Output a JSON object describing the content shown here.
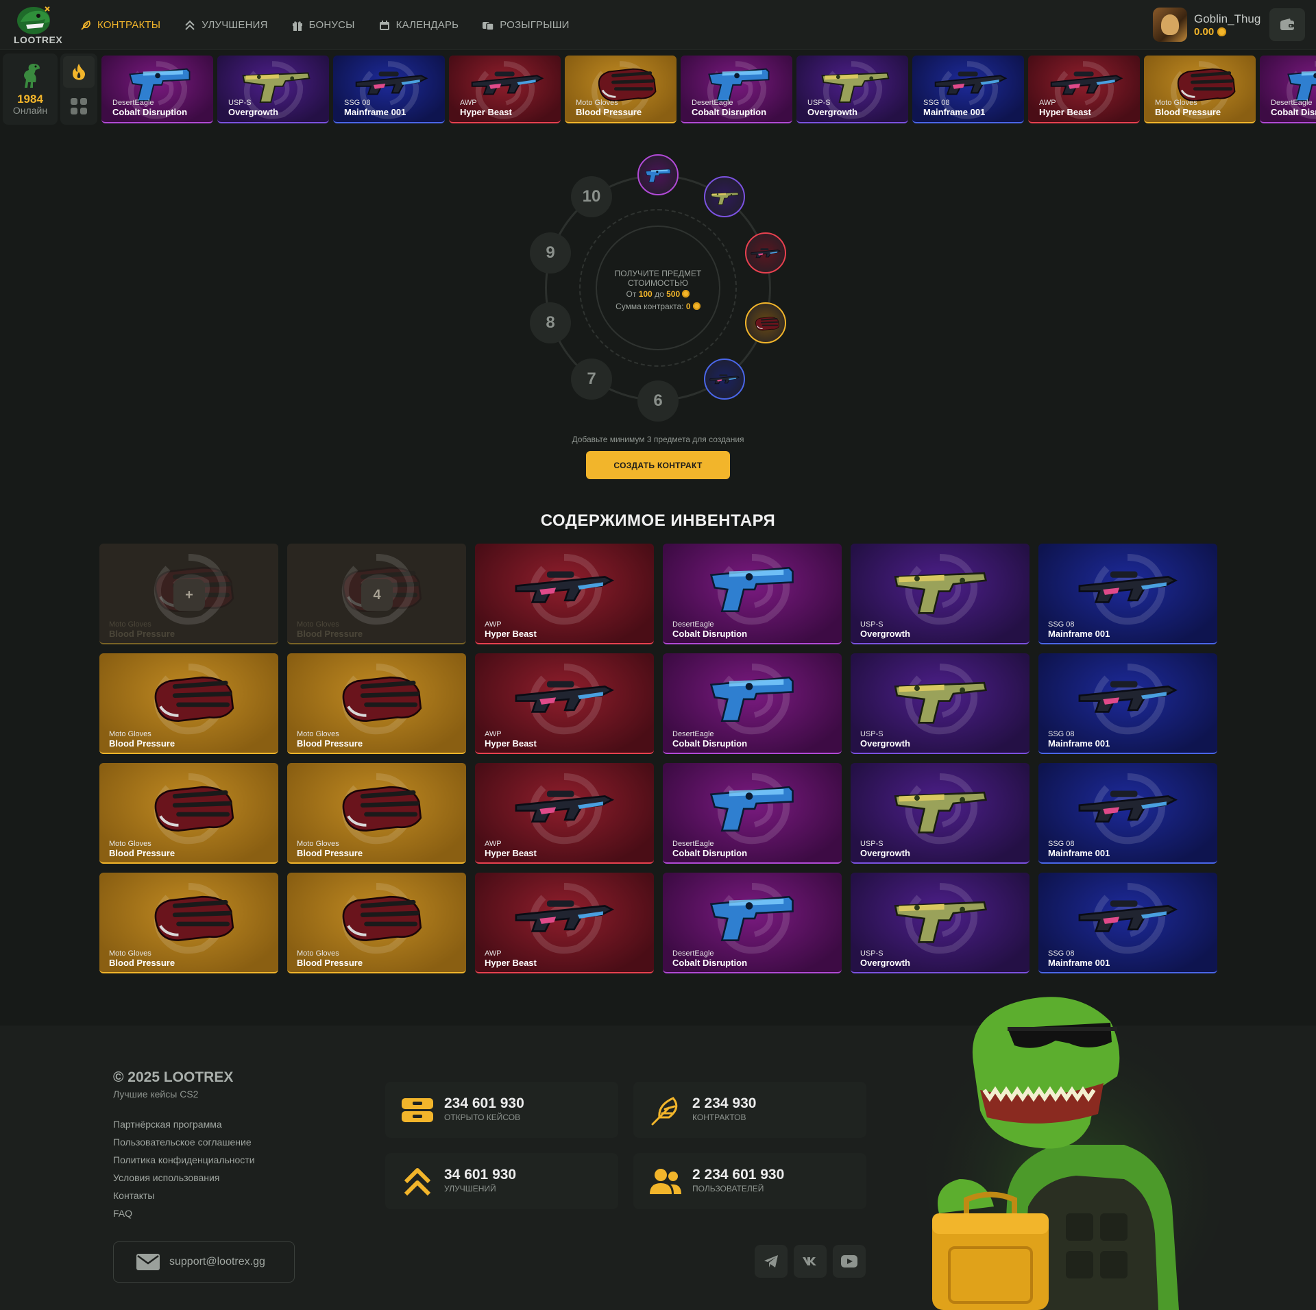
{
  "header": {
    "logo_text": "LOOTREX",
    "nav": [
      {
        "label": "КОНТРАКТЫ",
        "icon": "feather-icon"
      },
      {
        "label": "УЛУЧШЕНИЯ",
        "icon": "double-chevron-up-icon"
      },
      {
        "label": "БОНУСЫ",
        "icon": "gift-icon"
      },
      {
        "label": "КАЛЕНДАРЬ",
        "icon": "calendar-icon"
      },
      {
        "label": "РОЗЫГРЫШИ",
        "icon": "tickets-icon"
      }
    ],
    "active_nav": "КОНТРАКТЫ",
    "user": {
      "name": "Goblin_Thug",
      "balance": "0.00"
    }
  },
  "live": {
    "online_count": "1984",
    "online_label": "Онлайн",
    "drops": [
      {
        "weapon": "DesertEagle",
        "skin": "Cobalt Disruption",
        "rarity": "purple"
      },
      {
        "weapon": "USP-S",
        "skin": "Overgrowth",
        "rarity": "violet"
      },
      {
        "weapon": "SSG 08",
        "skin": "Mainframe 001",
        "rarity": "blue"
      },
      {
        "weapon": "AWP",
        "skin": "Hyper Beast",
        "rarity": "red"
      },
      {
        "weapon": "Moto Gloves",
        "skin": "Blood Pressure",
        "rarity": "gold"
      },
      {
        "weapon": "DesertEagle",
        "skin": "Cobalt Disruption",
        "rarity": "purple"
      },
      {
        "weapon": "USP-S",
        "skin": "Overgrowth",
        "rarity": "violet"
      },
      {
        "weapon": "SSG 08",
        "skin": "Mainframe 001",
        "rarity": "blue"
      },
      {
        "weapon": "AWP",
        "skin": "Hyper Beast",
        "rarity": "red"
      },
      {
        "weapon": "Moto Gloves",
        "skin": "Blood Pressure",
        "rarity": "gold"
      },
      {
        "weapon": "DesertEagle",
        "skin": "Cobalt Disruption",
        "rarity": "purple"
      }
    ]
  },
  "contract": {
    "slots": [
      {
        "label": "",
        "filled": "purple",
        "item": "pistol"
      },
      {
        "label": "",
        "filled": "violet",
        "item": "pistol2"
      },
      {
        "label": "",
        "filled": "red",
        "item": "rifle"
      },
      {
        "label": "",
        "filled": "gold",
        "item": "gloves"
      },
      {
        "label": "",
        "filled": "blue",
        "item": "rifle"
      },
      {
        "label": "6",
        "filled": "",
        "item": ""
      },
      {
        "label": "7",
        "filled": "",
        "item": ""
      },
      {
        "label": "8",
        "filled": "",
        "item": ""
      },
      {
        "label": "9",
        "filled": "",
        "item": ""
      },
      {
        "label": "10",
        "filled": "",
        "item": ""
      }
    ],
    "heading": "ПОЛУЧИТЕ ПРЕДМЕТ СТОИМОСТЬЮ",
    "range_from_label": "От",
    "range_from": "100",
    "range_to_label": "до",
    "range_to": "500",
    "sum_label": "Сумма контракта:",
    "sum_value": "0",
    "hint": "Добавьте минимум 3 предмета для создания",
    "create_button": "СОЗДАТЬ КОНТРАКТ"
  },
  "inventory": {
    "title": "СОДЕРЖИМОЕ ИНВЕНТАРЯ",
    "items": [
      {
        "weapon": "Moto Gloves",
        "skin": "Blood Pressure",
        "rarity": "empty",
        "badge": "+"
      },
      {
        "weapon": "Moto Gloves",
        "skin": "Blood Pressure",
        "rarity": "empty",
        "badge": "4"
      },
      {
        "weapon": "AWP",
        "skin": "Hyper Beast",
        "rarity": "red",
        "badge": ""
      },
      {
        "weapon": "DesertEagle",
        "skin": "Cobalt Disruption",
        "rarity": "purple",
        "badge": ""
      },
      {
        "weapon": "USP-S",
        "skin": "Overgrowth",
        "rarity": "violet",
        "badge": ""
      },
      {
        "weapon": "SSG 08",
        "skin": "Mainframe 001",
        "rarity": "blue",
        "badge": ""
      },
      {
        "weapon": "Moto Gloves",
        "skin": "Blood Pressure",
        "rarity": "gold",
        "badge": ""
      },
      {
        "weapon": "Moto Gloves",
        "skin": "Blood Pressure",
        "rarity": "gold",
        "badge": ""
      },
      {
        "weapon": "AWP",
        "skin": "Hyper Beast",
        "rarity": "red",
        "badge": ""
      },
      {
        "weapon": "DesertEagle",
        "skin": "Cobalt Disruption",
        "rarity": "purple",
        "badge": ""
      },
      {
        "weapon": "USP-S",
        "skin": "Overgrowth",
        "rarity": "violet",
        "badge": ""
      },
      {
        "weapon": "SSG 08",
        "skin": "Mainframe 001",
        "rarity": "blue",
        "badge": ""
      },
      {
        "weapon": "Moto Gloves",
        "skin": "Blood Pressure",
        "rarity": "gold",
        "badge": ""
      },
      {
        "weapon": "Moto Gloves",
        "skin": "Blood Pressure",
        "rarity": "gold",
        "badge": ""
      },
      {
        "weapon": "AWP",
        "skin": "Hyper Beast",
        "rarity": "red",
        "badge": ""
      },
      {
        "weapon": "DesertEagle",
        "skin": "Cobalt Disruption",
        "rarity": "purple",
        "badge": ""
      },
      {
        "weapon": "USP-S",
        "skin": "Overgrowth",
        "rarity": "violet",
        "badge": ""
      },
      {
        "weapon": "SSG 08",
        "skin": "Mainframe 001",
        "rarity": "blue",
        "badge": ""
      },
      {
        "weapon": "Moto Gloves",
        "skin": "Blood Pressure",
        "rarity": "gold",
        "badge": ""
      },
      {
        "weapon": "Moto Gloves",
        "skin": "Blood Pressure",
        "rarity": "gold",
        "badge": ""
      },
      {
        "weapon": "AWP",
        "skin": "Hyper Beast",
        "rarity": "red",
        "badge": ""
      },
      {
        "weapon": "DesertEagle",
        "skin": "Cobalt Disruption",
        "rarity": "purple",
        "badge": ""
      },
      {
        "weapon": "USP-S",
        "skin": "Overgrowth",
        "rarity": "violet",
        "badge": ""
      },
      {
        "weapon": "SSG 08",
        "skin": "Mainframe 001",
        "rarity": "blue",
        "badge": ""
      }
    ]
  },
  "footer": {
    "copyright": "© 2025 LOOTREX",
    "tagline": "Лучшие кейсы CS2",
    "links": [
      "Партнёрская программа",
      "Пользовательское соглашение",
      "Политика конфиденциальности",
      "Условия использования",
      "Контакты",
      "FAQ"
    ],
    "support_email": "support@lootrex.gg",
    "stats": [
      {
        "value": "234 601 930",
        "label": "ОТКРЫТО КЕЙСОВ",
        "icon": "case-icon"
      },
      {
        "value": "2 234 930",
        "label": "КОНТРАКТОВ",
        "icon": "feather-icon"
      },
      {
        "value": "34 601 930",
        "label": "УЛУЧШЕНИЙ",
        "icon": "double-chevron-up-icon"
      },
      {
        "value": "2 234 601 930",
        "label": "ПОЛЬЗОВАТЕЛЕЙ",
        "icon": "users-icon"
      }
    ],
    "socials": [
      "telegram-icon",
      "vk-icon",
      "youtube-icon"
    ]
  },
  "colors": {
    "accent": "#f2b52b",
    "background": "#171a18",
    "purple": "#b14ad6",
    "violet": "#7b52e0",
    "blue": "#4a66e8",
    "red": "#e8414f",
    "gold": "#f2b52b"
  }
}
